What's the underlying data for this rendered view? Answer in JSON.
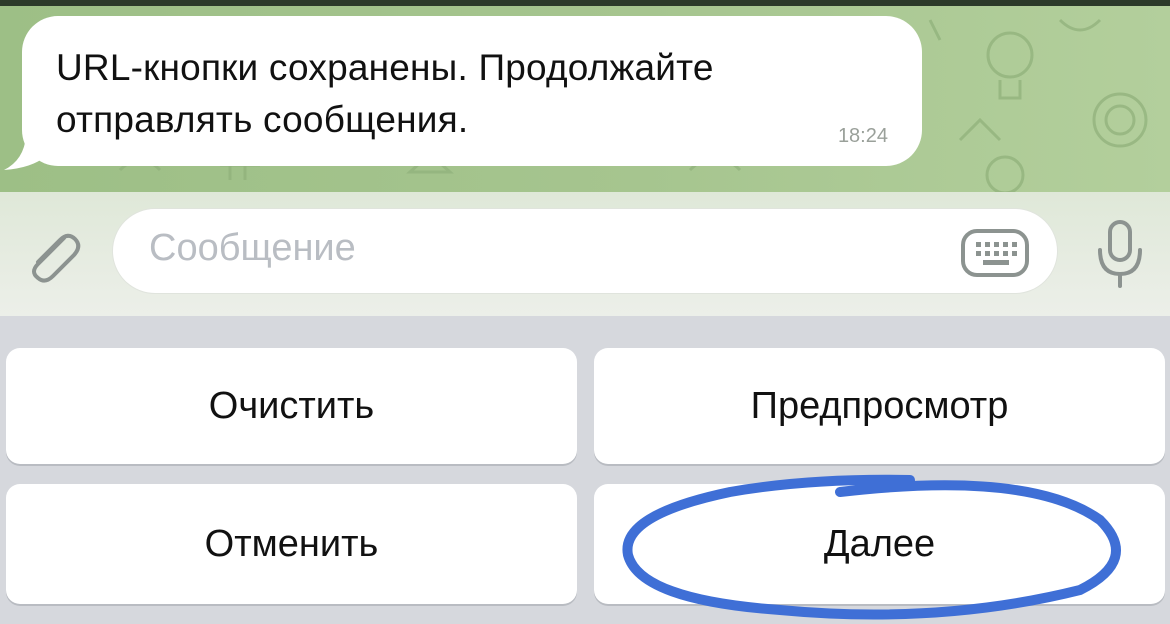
{
  "chat": {
    "message": {
      "text": "URL-кнопки сохранены. Продолжайте отправлять сообщения.",
      "time": "18:24"
    }
  },
  "input_bar": {
    "placeholder": "Сообщение",
    "icons": {
      "attach": "paperclip-icon",
      "keyboard": "keyboard-icon",
      "mic": "microphone-icon"
    }
  },
  "reply_keyboard": {
    "buttons": [
      {
        "label": "Очистить"
      },
      {
        "label": "Предпросмотр"
      },
      {
        "label": "Отменить"
      },
      {
        "label": "Далее"
      }
    ]
  },
  "colors": {
    "wallpaper": "#a6c58f",
    "highlight": "#3f6fd6",
    "keyboard_bg": "#d6d8dd"
  }
}
